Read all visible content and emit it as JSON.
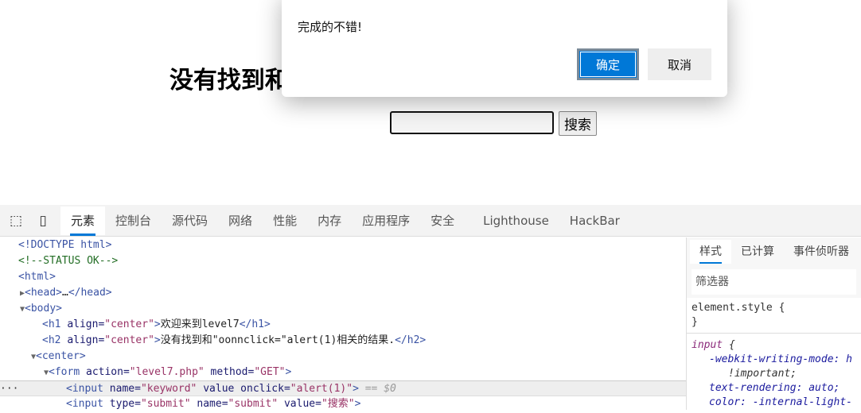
{
  "page": {
    "heading": "没有找到和\"oonnclick=\"alert(1)相关的结果.",
    "search_button": "搜索",
    "search_value": ""
  },
  "dialog": {
    "message": "完成的不错!",
    "ok": "确定",
    "cancel": "取消"
  },
  "devtools": {
    "tabs": [
      "元素",
      "控制台",
      "源代码",
      "网络",
      "性能",
      "内存",
      "应用程序",
      "安全",
      "Lighthouse",
      "HackBar"
    ],
    "active_tab": "元素",
    "tree": {
      "l1": "<!DOCTYPE html>",
      "l2": "<!--STATUS OK-->",
      "l3": "<html>",
      "l4a": "<head>",
      "l4b": "…",
      "l4c": "</head>",
      "l5": "<body>",
      "l6": {
        "open": "<h1 ",
        "attr": "align=",
        "val": "\"center\"",
        "close": ">",
        "text": "欢迎来到level7",
        "end": "</h1>"
      },
      "l7": {
        "open": "<h2 ",
        "attr": "align=",
        "val": "\"center\"",
        "close": ">",
        "text": "没有找到和\"oonnclick=\"alert(1)相关的结果.",
        "end": "</h2>"
      },
      "l8": "<center>",
      "l9": {
        "open": "<form ",
        "a1": "action=",
        "v1": "\"level7.php\"",
        "a2": " method=",
        "v2": "\"GET\"",
        "close": ">"
      },
      "l10": {
        "open": "<input ",
        "a1": "name=",
        "v1": "\"keyword\"",
        "a2": " value onclick=",
        "v2": "\"alert(1)\"",
        "close": ">",
        "ref": " == $0"
      },
      "l11": {
        "open": "<input ",
        "a1": "type=",
        "v1": "\"submit\"",
        "a2": " name=",
        "v2": "\"submit\"",
        "a3": " value=",
        "v3": "\"搜索\"",
        "close": ">"
      }
    },
    "styles": {
      "tabs": [
        "样式",
        "已计算",
        "事件侦听器"
      ],
      "filter_placeholder": "筛选器",
      "r1a": "element.style {",
      "r1b": "}",
      "r2sel": "input",
      "r2brace": " {",
      "p1": "-webkit-writing-mode: h",
      "p1b": "!important;",
      "p2": "text-rendering: auto;",
      "p3": "color: -internal-light-"
    }
  }
}
